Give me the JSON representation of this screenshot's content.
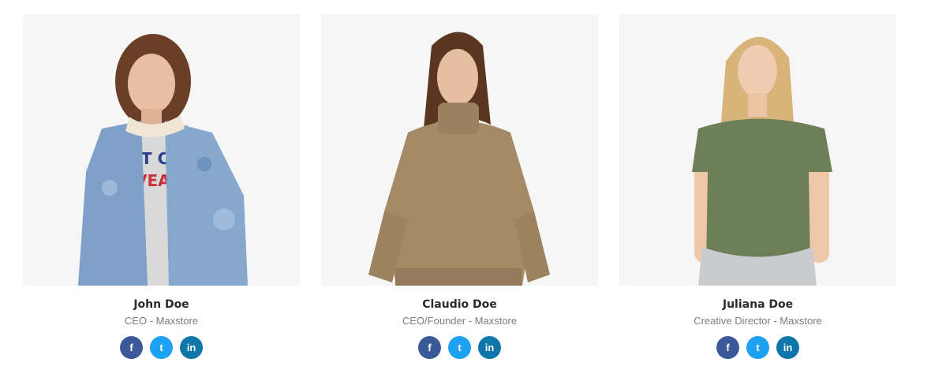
{
  "team": [
    {
      "name": "John Doe",
      "role": "CEO - Maxstore",
      "photo_icon": "person-denim-jacket-photo"
    },
    {
      "name": "Claudio Doe",
      "role": "CEO/Founder - Maxstore",
      "photo_icon": "person-knit-sweater-photo"
    },
    {
      "name": "Juliana Doe",
      "role": "Creative Director - Maxstore",
      "photo_icon": "person-green-tshirt-photo"
    }
  ],
  "social": {
    "facebook_glyph": "f",
    "twitter_glyph": "t",
    "linkedin_glyph": "in"
  },
  "colors": {
    "facebook": "#3b5998",
    "twitter": "#1da1f2",
    "linkedin": "#0e76a8",
    "photo_bg": "#f6f6f6"
  }
}
